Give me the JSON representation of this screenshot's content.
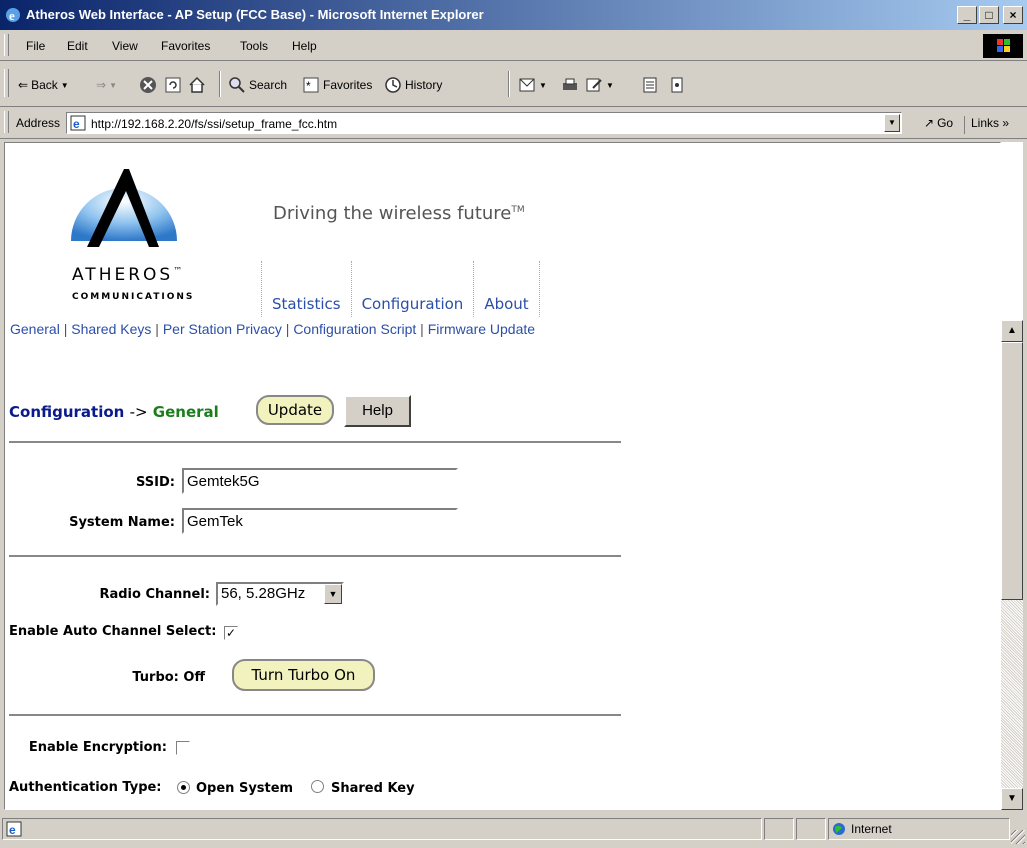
{
  "window": {
    "title": "Atheros Web Interface - AP Setup (FCC Base) - Microsoft Internet Explorer",
    "buttons": {
      "minimize": "_",
      "maximize": "□",
      "close": "×"
    }
  },
  "menubar": {
    "items": [
      "File",
      "Edit",
      "View",
      "Favorites",
      "Tools",
      "Help"
    ]
  },
  "toolbar": {
    "back": "Back",
    "search": "Search",
    "favorites": "Favorites",
    "history": "History"
  },
  "address": {
    "label": "Address",
    "url": "http://192.168.2.20/fs/ssi/setup_frame_fcc.htm",
    "go": "Go",
    "links": "Links"
  },
  "page": {
    "brand_name": "ATHEROS",
    "brand_tm": "™",
    "brand_sub": "COMMUNICATIONS",
    "tagline": "Driving the wireless future",
    "tagline_tm": "TM",
    "nav": [
      "Statistics",
      "Configuration",
      "About"
    ],
    "sublinks": [
      "General",
      "Shared Keys",
      "Per Station Privacy",
      "Configuration Script",
      "Firmware Update"
    ],
    "heading": {
      "section": "Configuration",
      "arrow": "->",
      "sub": "General"
    },
    "update_label": "Update",
    "help_label": "Help",
    "ssid_label": "SSID:",
    "ssid_value": "Gemtek5G",
    "sysname_label": "System Name:",
    "sysname_value": "GemTek",
    "channel_label": "Radio Channel:",
    "channel_value": "56, 5.28GHz",
    "auto_channel_label": "Enable Auto Channel Select:",
    "auto_channel_checked": true,
    "turbo_label": "Turbo: Off",
    "turbo_button": "Turn Turbo On",
    "encryption_label": "Enable Encryption:",
    "encryption_checked": false,
    "auth_label": "Authentication Type:",
    "auth_options": [
      "Open System",
      "Shared Key"
    ],
    "auth_selected": "Open System"
  },
  "status": {
    "zone": "Internet"
  }
}
